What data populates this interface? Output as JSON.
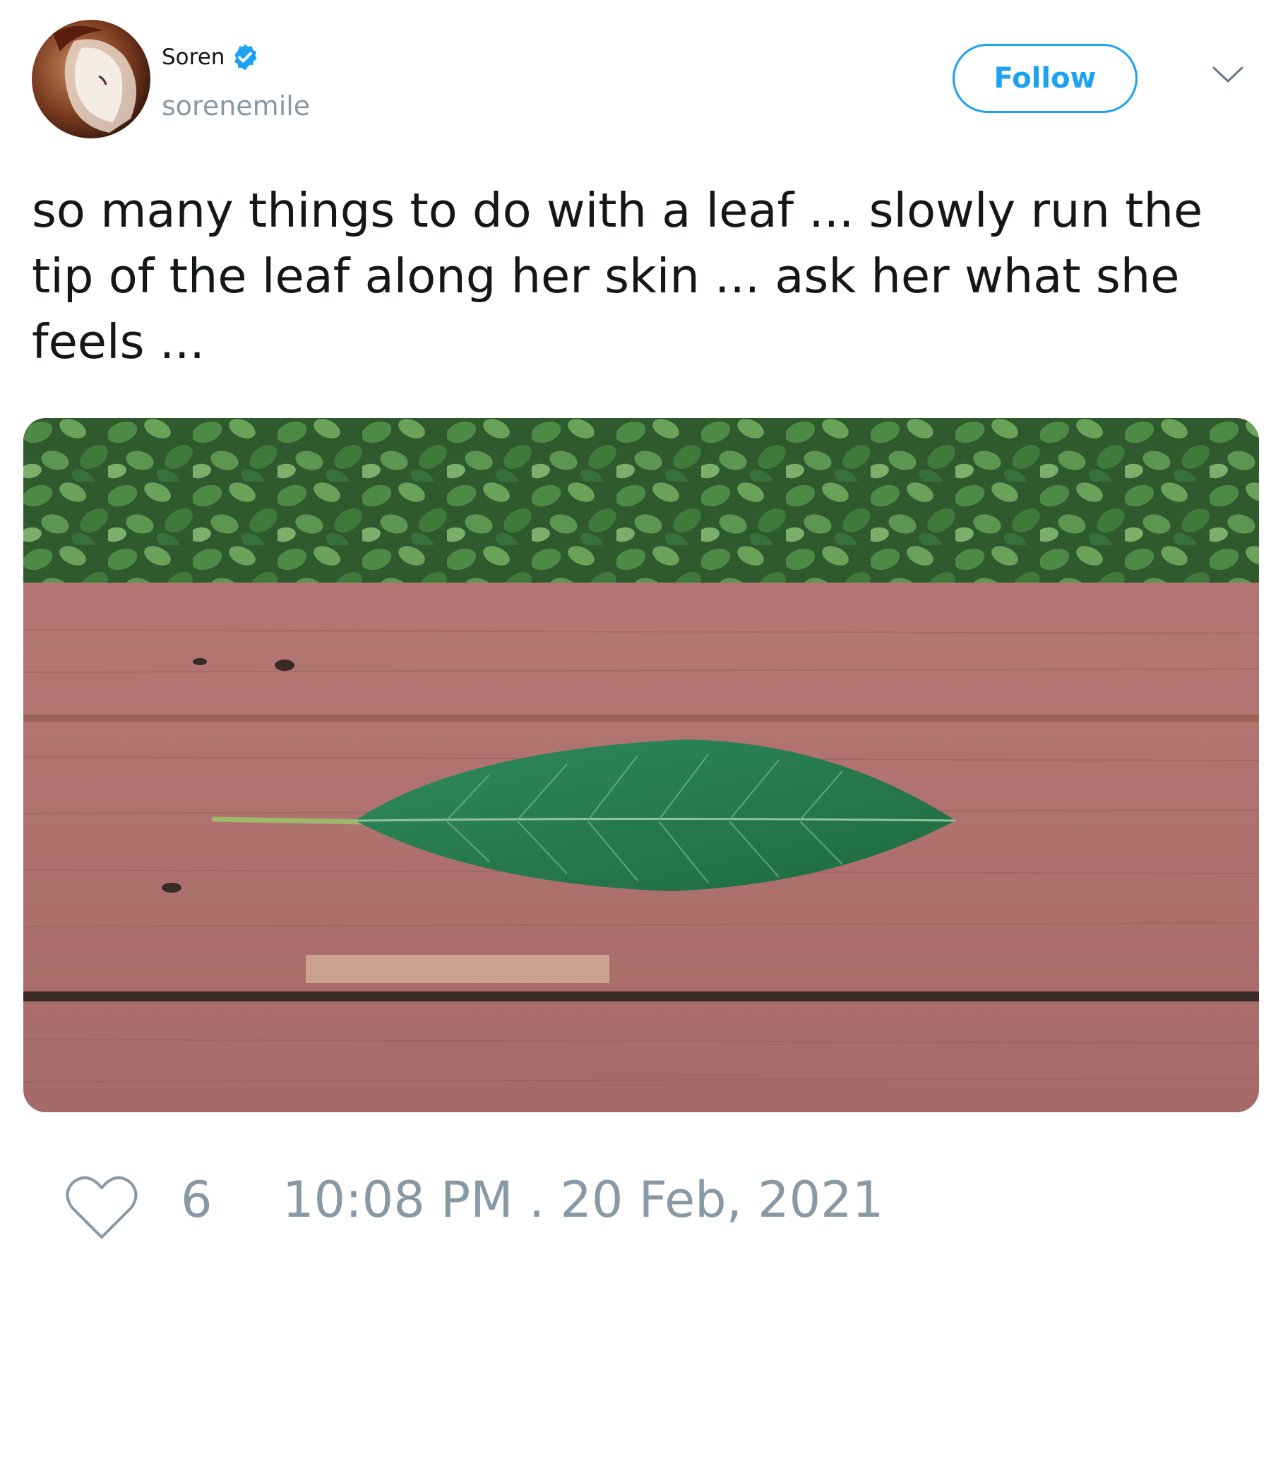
{
  "author": {
    "display_name": "Soren",
    "username": "sorenemile",
    "verified": true,
    "verified_icon": "verified-badge-icon"
  },
  "actions": {
    "follow_label": "Follow",
    "menu_icon": "chevron-down-icon"
  },
  "tweet": {
    "text": "so many things to do with a leaf ... slowly run the tip of the leaf along her skin ... ask her what she feels ..."
  },
  "media": {
    "type": "photo"
  },
  "footer": {
    "like_icon": "heart-outline-icon",
    "like_count": "6",
    "timestamp": "10:08 PM . 20 Feb, 2021"
  },
  "colors": {
    "accent": "#1da1f2",
    "text_primary": "#14171a",
    "text_secondary": "#8899a6"
  }
}
